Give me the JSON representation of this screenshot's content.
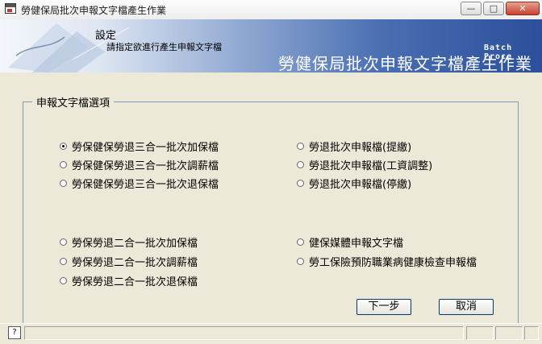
{
  "window": {
    "title": "勞健保局批次申報文字檔產生作業",
    "minimize_glyph": "—",
    "maximize_glyph": "□",
    "close_glyph": "✕"
  },
  "banner": {
    "heading": "設定",
    "subheading": "請指定欲進行產生申報文字檔",
    "english_tag": "Batch Proce",
    "title": "勞健保局批次申報文字檔產生作業"
  },
  "options": {
    "legend": "申報文字檔選項",
    "left_group_1": [
      {
        "label": "勞保健保勞退三合一批次加保檔",
        "selected": true
      },
      {
        "label": "勞保健保勞退三合一批次調薪檔",
        "selected": false
      },
      {
        "label": "勞保健保勞退三合一批次退保檔",
        "selected": false
      }
    ],
    "right_group_1": [
      {
        "label": "勞退批次申報檔(提繳)",
        "selected": false
      },
      {
        "label": "勞退批次申報檔(工資調整)",
        "selected": false
      },
      {
        "label": "勞退批次申報檔(停繳)",
        "selected": false
      }
    ],
    "left_group_2": [
      {
        "label": "勞保勞退二合一批次加保檔",
        "selected": false
      },
      {
        "label": "勞保勞退二合一批次調薪檔",
        "selected": false
      },
      {
        "label": "勞保勞退二合一批次退保檔",
        "selected": false
      }
    ],
    "right_group_2": [
      {
        "label": "健保媒體申報文字檔",
        "selected": false
      },
      {
        "label": "勞工保險預防職業病健康檢查申報檔",
        "selected": false
      }
    ]
  },
  "buttons": {
    "next": "下一步",
    "cancel": "取消"
  },
  "status": {
    "help_icon": "?"
  }
}
